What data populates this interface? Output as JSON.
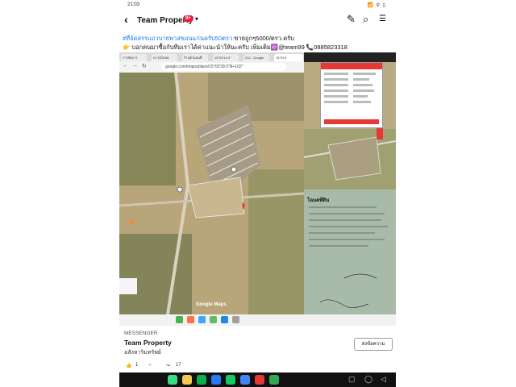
{
  "statusbar": {
    "time": "21:03",
    "icons": "📶 ⚲ ▯"
  },
  "header": {
    "back": "‹",
    "title": "Team Property",
    "badge": "9+",
    "caret": "▾",
    "edit_icon": "✎",
    "search_icon": "⌕",
    "messenger_icon": "☰"
  },
  "post": {
    "line1_tag": "#ที่จัดสรรแถวบายพาสขอนแก่นครับ50ตรว.",
    "line1_rest": "ขายถูกๆ5000/ตรว.ครับ",
    "line2": "👉 บอกคนมาซื้อกับทีมเราได้ค่าแนะนำให้นะครับ เพิ่มเติม🆔@team99 📞0885823318"
  },
  "browser": {
    "tabs": [
      "การจัดการ",
      "ดาวน์โหลด",
      "ร้านค้าแผนที่",
      "15°03'14.0\"",
      "212 - Google",
      "15°03'3"
    ],
    "url": "google.com/maps/place/15°03'39.5\"N+102°",
    "watermark": "Google Maps"
  },
  "doc": {
    "title": "โฉนดที่ดิน"
  },
  "share": {
    "label": "MESSENGER",
    "name": "Team Property",
    "sub": "อสังหาริมทรัพย์",
    "send": "ส่งข้อความ"
  },
  "actions": {
    "likes": "1",
    "shares": "17"
  },
  "colors": {
    "accent": "#1877f2",
    "badge": "#e41e3f",
    "pin": "#e53935"
  }
}
